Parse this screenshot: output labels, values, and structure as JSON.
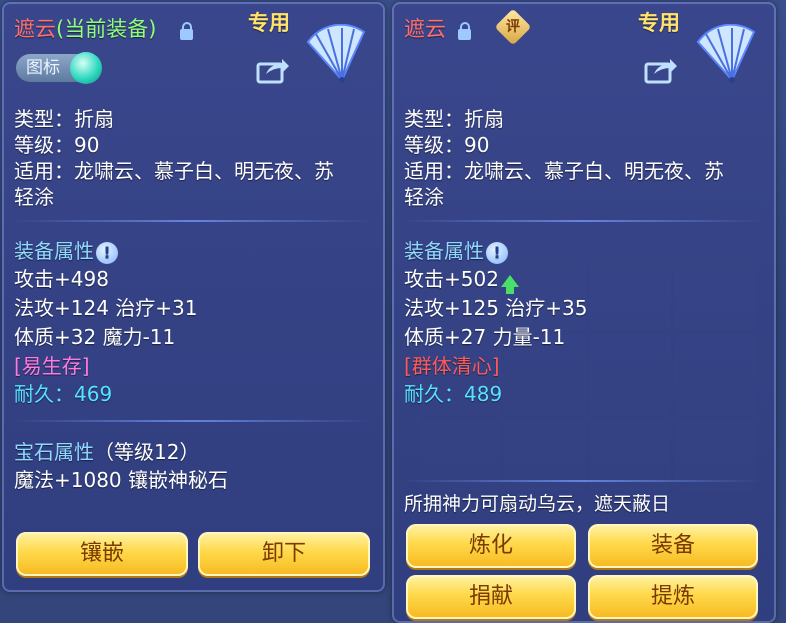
{
  "left": {
    "name": "遮云",
    "equipped": "(当前装备)",
    "exclusive": "专用",
    "tag_label": "图标",
    "type": "类型：折扇",
    "level": "等级：90",
    "usable_line1": "适用：龙啸云、慕子白、明无夜、苏",
    "usable_line2": "轻涂",
    "attr_title": "装备属性",
    "attack": "攻击+498",
    "line_magic_heal": "法攻+124 治疗+31",
    "line_phys_mp": "体质+32 魔力-11",
    "special": "[易生存]",
    "durability_label": "耐久：",
    "durability": "469",
    "gem_title": "宝石属性",
    "gem_level": "（等级12）",
    "gem_effect": "魔法+1080 镶嵌神秘石",
    "buttons": [
      "镶嵌",
      "卸下"
    ]
  },
  "right": {
    "name": "遮云",
    "rating_icon": "评",
    "exclusive": "专用",
    "type": "类型：折扇",
    "level": "等级：90",
    "usable_line1": "适用：龙啸云、慕子白、明无夜、苏",
    "usable_line2": "轻涂",
    "attr_title": "装备属性",
    "attack": "攻击+502",
    "line_magic_heal": "法攻+125 治疗+35",
    "line_phys_str": "体质+27 力量-11",
    "special": "[群体清心]",
    "durability_label": "耐久：",
    "durability": "489",
    "description": "所拥神力可扇动乌云，遮天蔽日",
    "buttons": [
      "炼化",
      "装备",
      "捐献",
      "提炼"
    ]
  },
  "colors": {
    "name": "#ff6f6f",
    "equipped": "#8fff7a",
    "exclusive": "#ffe36a",
    "section": "#8fd8ff",
    "special_left": "#ff7adf",
    "special_right": "#ff5a5a",
    "durability": "#56e3ff",
    "button": "#ffd94a"
  }
}
